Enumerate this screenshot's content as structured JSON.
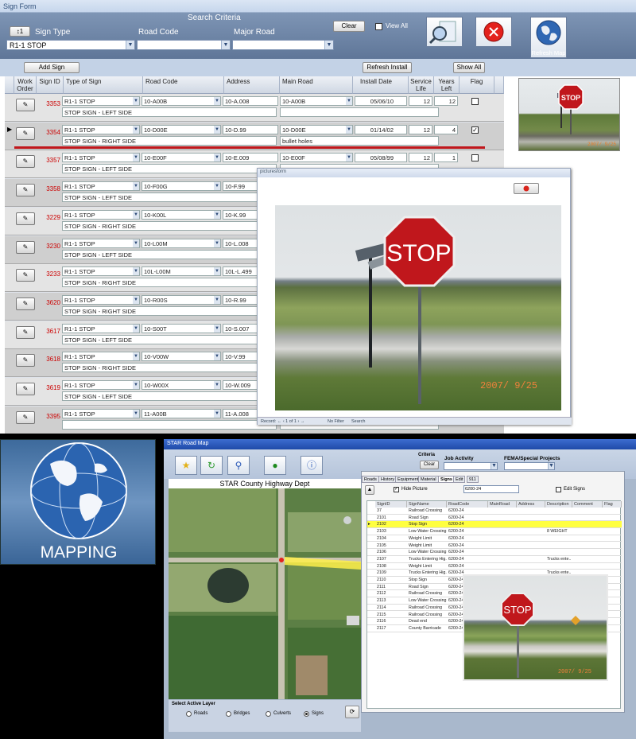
{
  "sign_form": {
    "title": "Sign Form",
    "search_criteria_label": "Search Criteria",
    "sort_button": "↕1",
    "sign_type_label": "Sign Type",
    "road_code_label": "Road Code",
    "major_road_label": "Major Road",
    "sign_type_value": "R1-1  STOP",
    "clear_button": "Clear",
    "view_all_label": "View All",
    "refresh_map_button": "Refresh Map",
    "add_sign_button": "Add Sign",
    "refresh_install_button": "Refresh Install",
    "show_all_button": "Show All",
    "columns": [
      "Work Order",
      "Sign ID",
      "Type of Sign",
      "Road Code",
      "Address",
      "Main Road",
      "Install Date",
      "Service Life",
      "Years Left",
      "Flag"
    ],
    "rows": [
      {
        "id": "3353",
        "type": "R1-1  STOP",
        "road": "10-A00B",
        "address": "10-A.008",
        "main": "10-A00B",
        "date": "05/06/10",
        "life": "12",
        "left": "12",
        "flag": false,
        "desc": "STOP SIGN - LEFT SIDE",
        "comment": ""
      },
      {
        "id": "3354",
        "type": "R1-1  STOP",
        "road": "10-D00E",
        "address": "10-D.99",
        "main": "10-D00E",
        "date": "01/14/02",
        "life": "12",
        "left": "4",
        "flag": true,
        "desc": "STOP SIGN - RIGHT SIDE",
        "comment": "bullet holes"
      },
      {
        "id": "3357",
        "type": "R1-1  STOP",
        "road": "10-E00F",
        "address": "10-E.009",
        "main": "10-E00F",
        "date": "05/08/99",
        "life": "12",
        "left": "1",
        "flag": false,
        "desc": "STOP SIGN - LEFT SIDE",
        "comment": ""
      },
      {
        "id": "3358",
        "type": "R1-1  STOP",
        "road": "10-F00G",
        "address": "10-F.99",
        "main": "",
        "date": "",
        "life": "",
        "left": "",
        "flag": false,
        "desc": "STOP SIGN - LEFT SIDE",
        "comment": ""
      },
      {
        "id": "3229",
        "type": "R1-1  STOP",
        "road": "10-K00L",
        "address": "10-K.99",
        "main": "",
        "date": "",
        "life": "",
        "left": "",
        "flag": false,
        "desc": "STOP SIGN - RIGHT SIDE",
        "comment": ""
      },
      {
        "id": "3230",
        "type": "R1-1  STOP",
        "road": "10-L00M",
        "address": "10-L.008",
        "main": "",
        "date": "",
        "life": "",
        "left": "",
        "flag": false,
        "desc": "STOP SIGN - LEFT SIDE",
        "comment": ""
      },
      {
        "id": "3233",
        "type": "R1-1  STOP",
        "road": "10L-L00M",
        "address": "10L-L.499",
        "main": "",
        "date": "",
        "life": "",
        "left": "",
        "flag": false,
        "desc": "STOP SIGN - RIGHT SIDE",
        "comment": ""
      },
      {
        "id": "3620",
        "type": "R1-1  STOP",
        "road": "10-R00S",
        "address": "10-R.99",
        "main": "",
        "date": "",
        "life": "",
        "left": "",
        "flag": false,
        "desc": "STOP SIGN - RIGHT SIDE",
        "comment": ""
      },
      {
        "id": "3617",
        "type": "R1-1  STOP",
        "road": "10-S00T",
        "address": "10-S.007",
        "main": "",
        "date": "",
        "life": "",
        "left": "",
        "flag": false,
        "desc": "STOP SIGN - LEFT SIDE",
        "comment": ""
      },
      {
        "id": "3618",
        "type": "R1-1  STOP",
        "road": "10-V00W",
        "address": "10-V.99",
        "main": "",
        "date": "",
        "life": "",
        "left": "",
        "flag": false,
        "desc": "STOP SIGN - RIGHT SIDE",
        "comment": ""
      },
      {
        "id": "3619",
        "type": "R1-1  STOP",
        "road": "10-W00X",
        "address": "10-W.009",
        "main": "",
        "date": "",
        "life": "",
        "left": "",
        "flag": false,
        "desc": "STOP SIGN - LEFT SIDE",
        "comment": ""
      },
      {
        "id": "3395",
        "type": "R1-1  STOP",
        "road": "11-A00B",
        "address": "11-A.008",
        "main": "",
        "date": "",
        "life": "",
        "left": "",
        "flag": false,
        "desc": "",
        "comment": ""
      }
    ],
    "thumb_stamp": "2007/ 9/25"
  },
  "picture_form": {
    "title": "picturesform",
    "sign_text": "STOP",
    "date_stamp": "2007/ 9/25",
    "record_label": "Record: ←  ‹  1 of 1  ›  →",
    "no_filter": "No Filter",
    "search": "Search"
  },
  "mapping_panel": {
    "label": "MAPPING"
  },
  "road_map": {
    "title": "STAR Road Map",
    "map_title": "STAR County Highway Dept",
    "criteria_label": "Criteria",
    "clear_button": "Clear",
    "job_activity_label": "Job Activity",
    "fema_label": "FEMA/Special Projects",
    "tabs": [
      "Roads",
      "History",
      "Equipment",
      "Material",
      "Signs",
      "Edit",
      "911"
    ],
    "hide_picture_label": "Hide Picture",
    "road_code_value": "6200-24",
    "edit_signs_label": "Edit Signs",
    "select_layer_label": "Select Active Layer",
    "layers": [
      "Roads",
      "Bridges",
      "Culverts",
      "Signs"
    ],
    "columns": [
      "SignID",
      "SignName",
      "RoadCode",
      "MainRoad",
      "Address",
      "Description",
      "Comment",
      "Flag"
    ],
    "rows": [
      {
        "id": "37",
        "name": "Railroad Crossing",
        "code": "6200-24",
        "desc": ""
      },
      {
        "id": "2101",
        "name": "Road Sign",
        "code": "6200-24",
        "desc": ""
      },
      {
        "id": "2102",
        "name": "Stop Sign",
        "code": "6200-24",
        "desc": ""
      },
      {
        "id": "2103",
        "name": "Low Water Crossing",
        "code": "6200-24",
        "desc": "8 WEIGHT"
      },
      {
        "id": "2104",
        "name": "Weight Limit",
        "code": "6200-24",
        "desc": ""
      },
      {
        "id": "2105",
        "name": "Weight Limit",
        "code": "6200-24",
        "desc": ""
      },
      {
        "id": "2106",
        "name": "Low Water Crossing",
        "code": "6200-24",
        "desc": ""
      },
      {
        "id": "2107",
        "name": "Trucks Entering Hig..",
        "code": "6200-24",
        "desc": "Trucks ente.."
      },
      {
        "id": "2108",
        "name": "Weight Limit",
        "code": "6200-24",
        "desc": ""
      },
      {
        "id": "2109",
        "name": "Trucks Entering Hig..",
        "code": "6200-24",
        "desc": "Trucks ente.."
      },
      {
        "id": "2110",
        "name": "Stop Sign",
        "code": "6200-24",
        "desc": ""
      },
      {
        "id": "2111",
        "name": "Road Sign",
        "code": "6200-24",
        "desc": ""
      },
      {
        "id": "2112",
        "name": "Railroad Crossing",
        "code": "6200-24",
        "desc": ""
      },
      {
        "id": "2113",
        "name": "Low Water Crossing",
        "code": "6200-24",
        "desc": ""
      },
      {
        "id": "2114",
        "name": "Railroad Crossing",
        "code": "6200-24",
        "desc": ""
      },
      {
        "id": "2115",
        "name": "Railroad Crossing",
        "code": "6200-24",
        "desc": ""
      },
      {
        "id": "2116",
        "name": "Dead end",
        "code": "6200-24",
        "desc": ""
      },
      {
        "id": "2117",
        "name": "County Barricade",
        "code": "6200-24",
        "desc": ""
      }
    ],
    "highlight_row": 2,
    "photo_sign_text": "STOP",
    "photo_stamp": "2007/ 9/25"
  },
  "colors": {
    "accent_blue": "#5f7698",
    "highlight": "#ffff40",
    "sign_red": "#c0171c",
    "id_red": "#cc0000"
  }
}
